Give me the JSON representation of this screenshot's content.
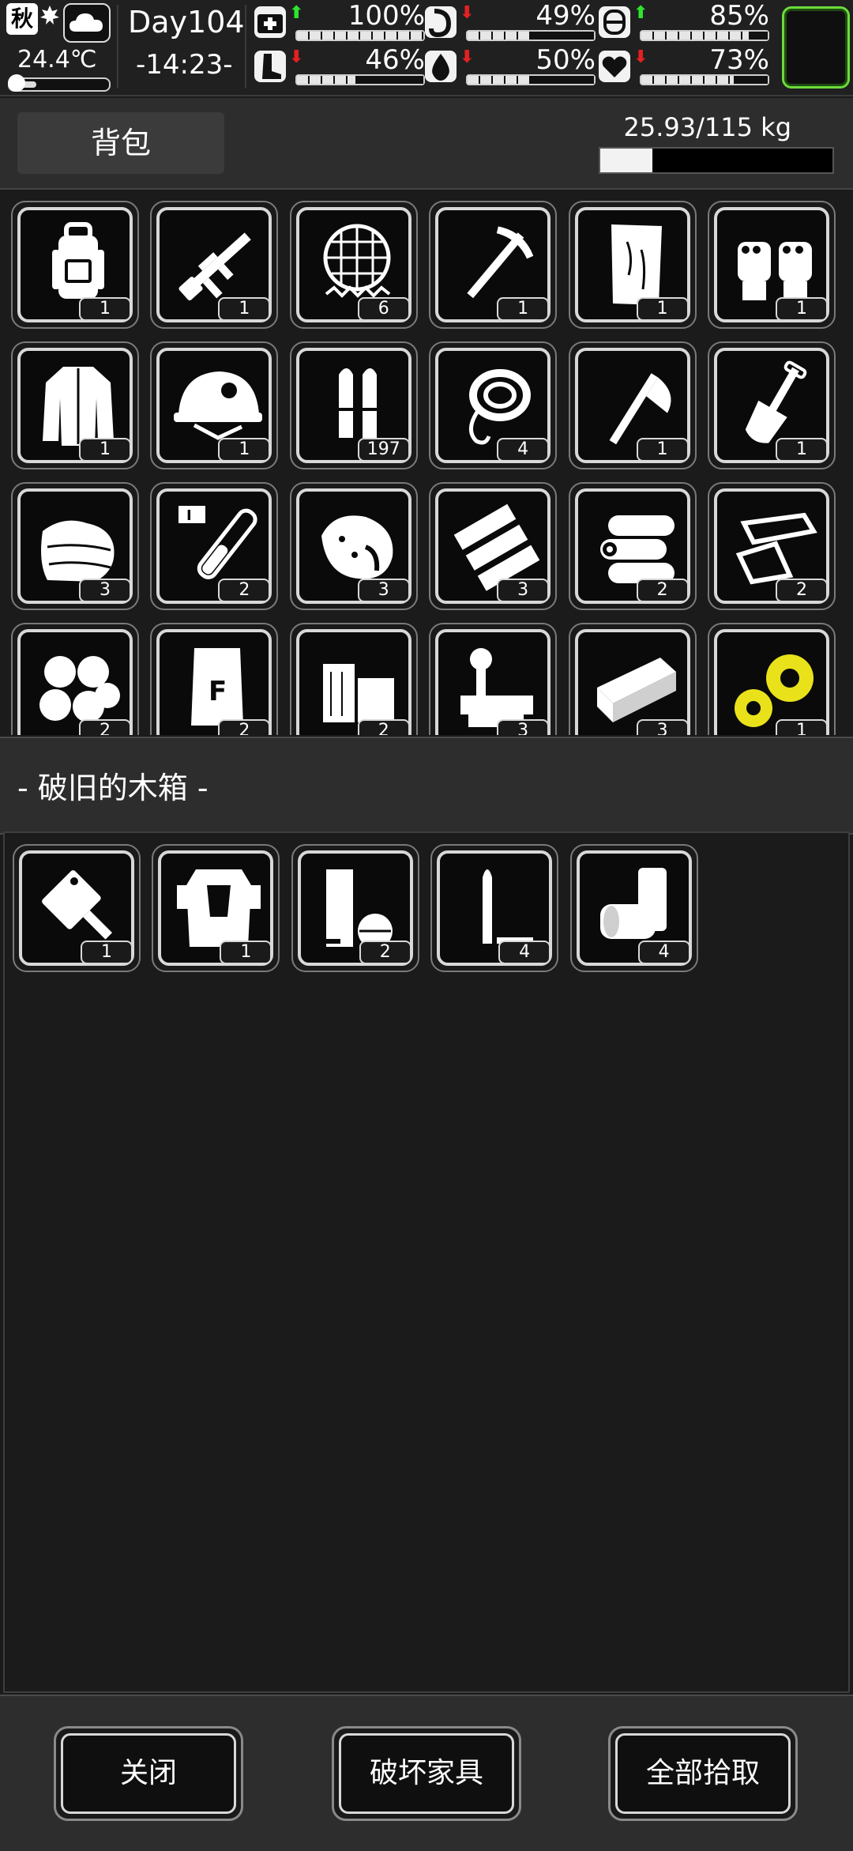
{
  "status": {
    "season": "秋",
    "temperature": "24.4℃",
    "temperature_level": 0.22,
    "day": "Day104",
    "time": "-14:23-",
    "stats": [
      {
        "name": "health",
        "icon": "medkit-icon",
        "trend": "up",
        "percent": "100%",
        "level": 1.0
      },
      {
        "name": "hunger",
        "icon": "stomach-icon",
        "trend": "down",
        "percent": "49%",
        "level": 0.49
      },
      {
        "name": "energy",
        "icon": "capsule-icon",
        "trend": "up",
        "percent": "85%",
        "level": 0.85
      },
      {
        "name": "stamina",
        "icon": "foot-icon",
        "trend": "down",
        "percent": "46%",
        "level": 0.46
      },
      {
        "name": "thirst",
        "icon": "water-drop-icon",
        "trend": "down",
        "percent": "50%",
        "level": 0.5
      },
      {
        "name": "mood",
        "icon": "heart-icon",
        "trend": "down",
        "percent": "73%",
        "level": 0.73
      }
    ],
    "colors": {
      "trend_up": "#2ee52e",
      "trend_down": "#e52020",
      "slot_border": "#6adc3a"
    }
  },
  "backpack": {
    "title": "背包",
    "weight": "25.93/115 kg",
    "weight_level": 0.2255,
    "items": [
      {
        "icon": "backpack-icon",
        "count": "1"
      },
      {
        "icon": "rifle-icon",
        "count": "1"
      },
      {
        "icon": "net-icon",
        "count": "6"
      },
      {
        "icon": "pickaxe-icon",
        "count": "1"
      },
      {
        "icon": "wood-plank-icon",
        "count": "1"
      },
      {
        "icon": "gloves-icon",
        "count": "1"
      },
      {
        "icon": "jacket-icon",
        "count": "1"
      },
      {
        "icon": "helmet-icon",
        "count": "1"
      },
      {
        "icon": "bullets-icon",
        "count": "197"
      },
      {
        "icon": "rope-icon",
        "count": "4"
      },
      {
        "icon": "axe-icon",
        "count": "1"
      },
      {
        "icon": "shovel-icon",
        "count": "1"
      },
      {
        "icon": "cloth-icon",
        "count": "3"
      },
      {
        "icon": "test-tube-icon",
        "count": "2"
      },
      {
        "icon": "meat-icon",
        "count": "3"
      },
      {
        "icon": "wood-boards-icon",
        "count": "3"
      },
      {
        "icon": "logs-icon",
        "count": "2"
      },
      {
        "icon": "metal-sheet-icon",
        "count": "2"
      },
      {
        "icon": "cotton-balls-icon",
        "count": "2"
      },
      {
        "icon": "fertilizer-bag-icon",
        "count": "2"
      },
      {
        "icon": "wood-blocks-icon",
        "count": "2"
      },
      {
        "icon": "bolts-icon",
        "count": "3"
      },
      {
        "icon": "ingot-icon",
        "count": "3"
      },
      {
        "icon": "gears-icon",
        "count": "1"
      }
    ]
  },
  "container": {
    "title": "- 破旧的木箱 -",
    "items": [
      {
        "icon": "cleaver-icon",
        "count": "1"
      },
      {
        "icon": "body-armor-icon",
        "count": "1"
      },
      {
        "icon": "battery-icon",
        "count": "2"
      },
      {
        "icon": "bullet-shell-icon",
        "count": "4"
      },
      {
        "icon": "cans-icon",
        "count": "4"
      }
    ]
  },
  "actions": {
    "close": "关闭",
    "destroy_furniture": "破坏家具",
    "pick_up_all": "全部拾取"
  }
}
